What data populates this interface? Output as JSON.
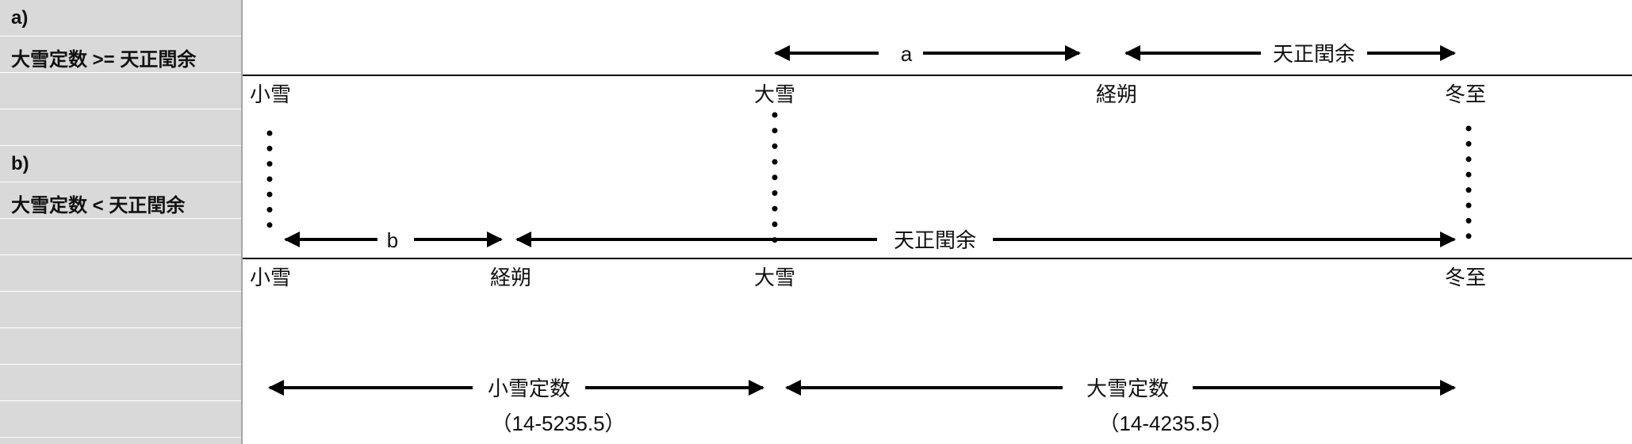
{
  "sidebar": {
    "case_a": "a)",
    "case_a_condition": "大雪定数 >= 天正閏余",
    "case_b": "b)",
    "case_b_condition": "大雪定数 < 天正閏余"
  },
  "case_a": {
    "span_a_label": "a",
    "span_leap_label": "天正閏余",
    "points": {
      "shousetsu": "小雪",
      "taisetsu": "大雪",
      "keisaku": "経朔",
      "touji": "冬至"
    }
  },
  "case_b": {
    "span_b_label": "b",
    "span_leap_label": "天正閏余",
    "points": {
      "shousetsu": "小雪",
      "keisaku": "経朔",
      "taisetsu": "大雪",
      "touji": "冬至"
    }
  },
  "constants": {
    "shousetsu_label": "小雪定数",
    "shousetsu_value": "（14-5235.5）",
    "taisetsu_label": "大雪定数",
    "taisetsu_value": "（14-4235.5）"
  },
  "colors": {
    "sidebar_bg": "#d9d9d9",
    "line": "#000000"
  }
}
